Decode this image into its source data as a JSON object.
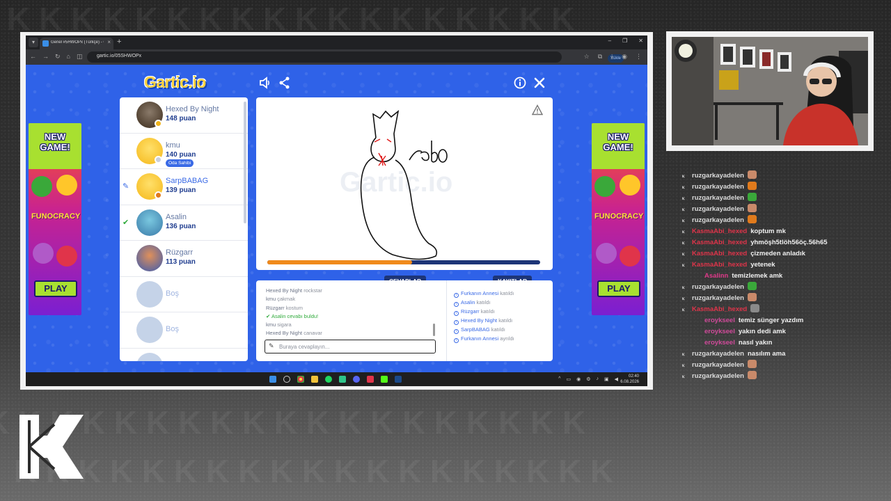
{
  "browser": {
    "tab_title": "Genel #5HWOPx (Türkçe) - Gar",
    "url": "gartic.io/05SHWOPx",
    "install_label": "Yükle"
  },
  "game": {
    "logo": "Gartic.io",
    "canvas_watermark": "Gartic.io",
    "timer_progress": 0.53,
    "players": [
      {
        "name": "Hexed By Night",
        "score": "148 puan",
        "avatar_color": "#5a4a3a",
        "dot_color": "#f0b41c",
        "mark": ""
      },
      {
        "name": "kmu",
        "score": "140 puan",
        "avatar_color": "#ffc62a",
        "dot_color": "#c9cfdd",
        "mark": "",
        "badge": "Oda Sahibi"
      },
      {
        "name": "SarpBABAG",
        "score": "139 puan",
        "avatar_color": "#ffc62a",
        "dot_color": "#e07a1c",
        "mark": "pencil"
      },
      {
        "name": "Asalin",
        "score": "136 puan",
        "avatar_color": "#5aa9c8",
        "dot_color": "",
        "mark": "check"
      },
      {
        "name": "Rüzgarr",
        "score": "113 puan",
        "avatar_color": "#3a6ac8",
        "dot_color": "",
        "mark": ""
      }
    ],
    "empty_slot_label": "Boş",
    "answers_label": "CEVAPLAR",
    "log_label": "KAYITLAR",
    "answers": [
      {
        "user": "Hexed By Night",
        "text": "rockstar",
        "correct": false
      },
      {
        "user": "kmu",
        "text": "çakmak",
        "correct": false
      },
      {
        "user": "Rüzgarr",
        "text": "kostum",
        "correct": false
      },
      {
        "user": "Asalin",
        "text": "cevabı buldu!",
        "correct": true
      },
      {
        "user": "kmu",
        "text": "sigara",
        "correct": false
      },
      {
        "user": "Hexed By Night",
        "text": "canavar",
        "correct": false
      }
    ],
    "answer_placeholder": "Buraya cevaplayın...",
    "log": [
      {
        "user": "Furkanın Annesi",
        "text": "katıldı"
      },
      {
        "user": "Asalin",
        "text": "katıldı"
      },
      {
        "user": "Rüzgarr",
        "text": "katıldı"
      },
      {
        "user": "Hexed By Night",
        "text": "katıldı"
      },
      {
        "user": "SarpBABAG",
        "text": "katıldı"
      },
      {
        "user": "Furkanın Annesi",
        "text": "ayrıldı"
      }
    ]
  },
  "ad": {
    "headline": "NEW GAME!",
    "brand": "FUNOCRACY",
    "cta": "PLAY"
  },
  "taskbar": {
    "time": "02:40",
    "date": "6.08.2026"
  },
  "chat": {
    "lines": [
      {
        "user": "ruzgarkayadelen",
        "color": "#dcdcdc",
        "msg": "",
        "emote": "#c98a6a",
        "indent": false
      },
      {
        "user": "ruzgarkayadelen",
        "color": "#dcdcdc",
        "msg": "",
        "emote": "#e07a1c",
        "indent": false
      },
      {
        "user": "ruzgarkayadelen",
        "color": "#dcdcdc",
        "msg": "",
        "emote": "#3aa83a",
        "indent": false
      },
      {
        "user": "ruzgarkayadelen",
        "color": "#dcdcdc",
        "msg": "",
        "emote": "#c98a6a",
        "indent": false
      },
      {
        "user": "ruzgarkayadelen",
        "color": "#dcdcdc",
        "msg": "",
        "emote": "#e07a1c",
        "indent": false
      },
      {
        "user": "KasmaAbi_hexed",
        "color": "#e0344a",
        "msg": "koptum mk",
        "emote": "",
        "indent": false
      },
      {
        "user": "KasmaAbi_hexed",
        "color": "#e0344a",
        "msg": "yhmöşh5tlöh56öç.56h65",
        "emote": "",
        "indent": false
      },
      {
        "user": "KasmaAbi_hexed",
        "color": "#e0344a",
        "msg": "çizmeden anladık",
        "emote": "",
        "indent": false
      },
      {
        "user": "KasmaAbi_hexed",
        "color": "#e0344a",
        "msg": "yetenek",
        "emote": "",
        "indent": false
      },
      {
        "user": "Asalinn",
        "color": "#e03a8a",
        "msg": "temizlemek amk",
        "emote": "",
        "indent": true
      },
      {
        "user": "ruzgarkayadelen",
        "color": "#dcdcdc",
        "msg": "",
        "emote": "#3aa83a",
        "indent": false
      },
      {
        "user": "ruzgarkayadelen",
        "color": "#dcdcdc",
        "msg": "",
        "emote": "#c98a6a",
        "indent": false
      },
      {
        "user": "KasmaAbi_hexed",
        "color": "#e0344a",
        "msg": "",
        "emote": "#8a8a8a",
        "indent": false
      },
      {
        "user": "eroykseel",
        "color": "#d04a9a",
        "msg": "temiz sünger yazdım",
        "emote": "",
        "indent": true
      },
      {
        "user": "eroykseel",
        "color": "#d04a9a",
        "msg": "yakın dedi amk",
        "emote": "",
        "indent": true
      },
      {
        "user": "eroykseel",
        "color": "#d04a9a",
        "msg": "nasıl yakın",
        "emote": "",
        "indent": true
      },
      {
        "user": "ruzgarkayadelen",
        "color": "#dcdcdc",
        "msg": "nasılım ama",
        "emote": "",
        "indent": false
      },
      {
        "user": "ruzgarkayadelen",
        "color": "#dcdcdc",
        "msg": "",
        "emote": "#c98a6a",
        "indent": false
      },
      {
        "user": "ruzgarkayadelen",
        "color": "#dcdcdc",
        "msg": "",
        "emote": "#c98a6a",
        "indent": false
      }
    ]
  }
}
